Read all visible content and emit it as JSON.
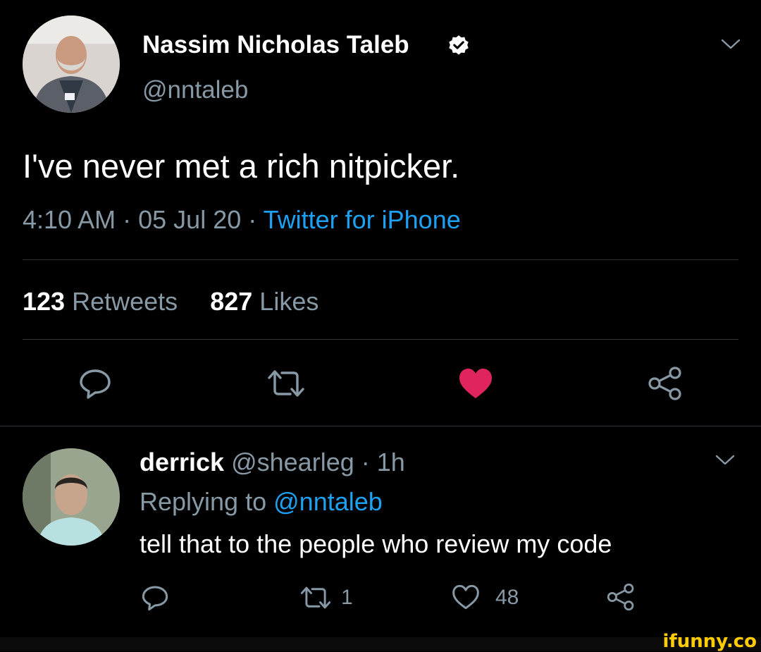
{
  "main_tweet": {
    "display_name": "Nassim Nicholas Taleb",
    "handle": "@nntaleb",
    "text": "I've never met a rich nitpicker.",
    "time": "4:10 AM",
    "date": "05 Jul 20",
    "separator": "·",
    "source": "Twitter for iPhone",
    "retweet_count": "123",
    "retweet_label": "Retweets",
    "like_count": "827",
    "like_label": "Likes"
  },
  "reply": {
    "display_name": "derrick",
    "handle": "@shearleg",
    "separator": "·",
    "age": "1h",
    "replying_label": "Replying to",
    "replying_to": "@nntaleb",
    "text": "tell that to the people who review my code",
    "retweet_count": "1",
    "like_count": "48"
  },
  "watermark": "ifunny.co",
  "colors": {
    "background": "#000000",
    "text": "#ffffff",
    "secondary_text": "#8899a6",
    "link": "#1da1f2",
    "liked_heart": "#e0245e",
    "divider": "#2f3336",
    "watermark": "#ffcc00"
  },
  "icons": {
    "verified": "verified-badge-icon",
    "chevron": "chevron-down-icon",
    "reply": "reply-icon",
    "retweet": "retweet-icon",
    "like": "heart-icon",
    "share": "share-icon"
  }
}
